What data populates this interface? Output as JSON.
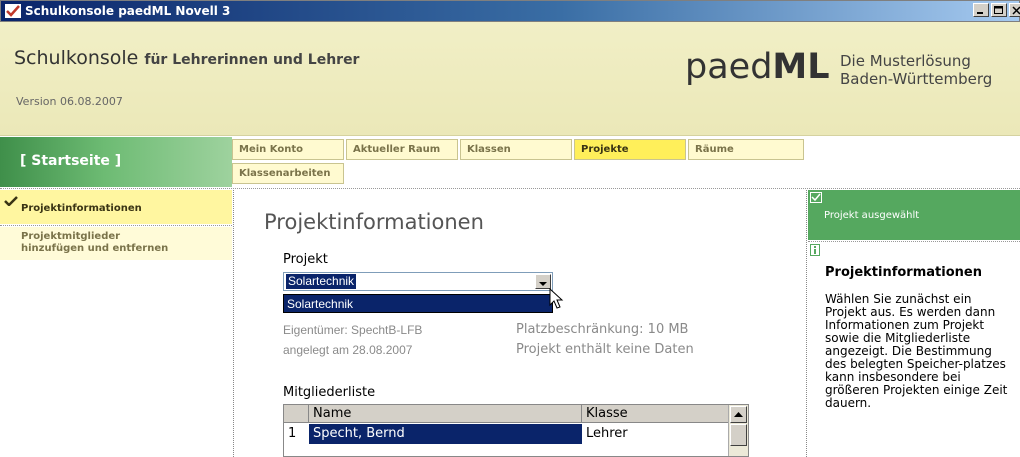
{
  "window": {
    "title": "Schulkonsole paedML Novell 3"
  },
  "header": {
    "app_name": "Schulkonsole",
    "app_subtitle": "für Lehrerinnen und Lehrer",
    "version": "Version 06.08.2007",
    "logo_light": "paed",
    "logo_bold": "ML",
    "tagline_line1": "Die Musterlösung",
    "tagline_line2": "Baden-Württemberg"
  },
  "nav": {
    "home_label": "[ Startseite ]",
    "tabs": [
      {
        "label": "Mein Konto",
        "active": false
      },
      {
        "label": "Aktueller Raum",
        "active": false
      },
      {
        "label": "Klassen",
        "active": false
      },
      {
        "label": "Projekte",
        "active": true
      },
      {
        "label": "Räume",
        "active": false
      },
      {
        "label": "Klassenarbeiten",
        "active": false
      }
    ],
    "side_items": [
      {
        "label": "Projektinformationen",
        "active": true
      },
      {
        "label_line1": "Projektmitglieder",
        "label_line2": "hinzufügen und entfernen",
        "active": false
      }
    ]
  },
  "main": {
    "title": "Projektinformationen",
    "project_label": "Projekt",
    "project_select_value": "Solartechnik",
    "dropdown_option": "Solartechnik",
    "owner": "Eigentümer: SpechtB-LFB",
    "created": "angelegt am 28.08.2007",
    "quota": "Platzbeschränkung: 10 MB",
    "content_status": "Projekt enthält keine Daten",
    "members_label": "Mitgliederliste",
    "table": {
      "columns": [
        "",
        "Name",
        "Klasse"
      ],
      "rows": [
        {
          "num": "1",
          "name": "Specht, Bernd",
          "klasse": "Lehrer"
        }
      ]
    }
  },
  "right_panel": {
    "status": "Projekt ausgewählt",
    "info_title": "Projektinformationen",
    "info_text": "Wählen Sie zunächst ein Projekt aus. Es werden dann Informationen zum Projekt sowie die Mitgliederliste angezeigt. Die Bestimmung des belegten Speicher-platzes kann insbesondere bei größeren Projekten einige Zeit dauern."
  },
  "colors": {
    "header_bg": "#ebe8b8",
    "accent_green": "#55a85f",
    "active_tab": "#ffef5a",
    "selection": "#0a246a"
  }
}
